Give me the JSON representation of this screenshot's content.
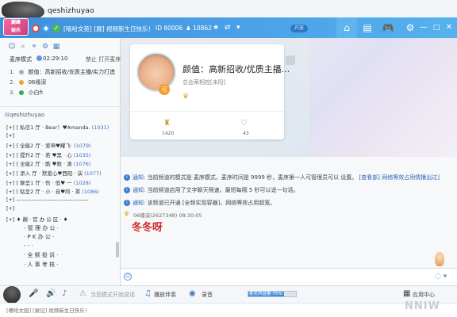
{
  "header": {
    "username": "qeshizhuyao"
  },
  "titlebar": {
    "logo_text": "巅峰\n娱乐",
    "title": "[嘻哈文苑] [展] 视频新生日快乐！",
    "room_id": "ID 80006",
    "online": "♟ 10862",
    "toggle_label": "开放",
    "nav": {
      "home": "⌂",
      "list": "▤",
      "game": "🎮",
      "settings": "⚙",
      "minimize": "—",
      "maximize": "□",
      "close": "✕"
    }
  },
  "left": {
    "mode_label": "麦序模式",
    "timer": "02:29:10",
    "action": "禁止 打开麦序",
    "mic_list": [
      {
        "num": "1.",
        "name": "颜值：高新招收/优质主播/实力打造",
        "dot": "#9cb3c9"
      },
      {
        "num": "2.",
        "name": "06缘深",
        "dot": "#e6a92d"
      },
      {
        "num": "3.",
        "name": "小白fi",
        "dot": "#34a853"
      }
    ],
    "channel_host": "qeshizhuyao",
    "channels": [
      {
        "text": "[+] [ 私信1 厅 · Bear！♥Amanda.",
        "count": "(1031)"
      },
      {
        "text": "[+]",
        "count": ""
      },
      {
        "text": "[+] [ 全能2 厅 · 爱神♥耀飞·",
        "count": "(1079)"
      },
      {
        "text": "[+] [ 提升2 厅 · 若 ♥黑 · 心",
        "count": "(1035)"
      },
      {
        "text": "[+] [ 全能2 厅 · 酷 ♥数 · 滴",
        "count": "(1076)"
      },
      {
        "text": "[+] [ 添入 厅 · 默爱心♥西阳 · 演",
        "count": "(1077)"
      },
      {
        "text": "[+] [ 聊呈1 厅 · 伤 · 低♥ 一",
        "count": "(1028)"
      },
      {
        "text": "[+] [ 贴呈2 厅 · 小 · 自♥阿 · 茶",
        "count": "(1086)"
      },
      {
        "text": "[+] ——————————————",
        "count": ""
      },
      {
        "text": "[+]",
        "count": ""
      },
      {
        "text": "[+] ♦ 巅 · 官 办 公 区 · ♦",
        "count": ""
      }
    ],
    "sub_channels": [
      "- 管 理 办 公 ·",
      "· P K 办 公 ·",
      "- - ·",
      "· 全 频 投 诉 ·",
      "· 人 事 考 核 ·"
    ]
  },
  "card": {
    "host_title": "颜值：高新招收/优质主播...",
    "host_sub": "总会荣相控[未阳]",
    "badge": "可",
    "trophy_count": "1420",
    "heart_count": "43"
  },
  "chat": {
    "notices": [
      {
        "label": "通知:",
        "text": "当前频道的模式是 麦序模式，麦序时间是 9999 秒，麦序第一人可管理员可以 设置。",
        "link": "[查看部] 网络等效占用情播出过]"
      },
      {
        "label": "通知:",
        "text": "当前频道启用了文字聊天限速，最短每隔 5 秒可以说一句话。",
        "link": ""
      },
      {
        "label": "通知:",
        "text": "该频道已开通 [全频实现容器]，网络等效占用超宽。",
        "link": ""
      }
    ],
    "user": "06缘深(2627348)  08:30:05",
    "message": "冬冬呀"
  },
  "bottombar": {
    "voice_mode": "当您模式开始说话",
    "accompany": "播放伴奏",
    "record": "录音",
    "progress_text": "麦克风音量 75%",
    "progress_value": 0.75,
    "app_center": "应用中心"
  },
  "status": {
    "text": "[嘻哈文园] [展记] 视频新生日快乐！"
  },
  "watermark": "NNIW"
}
